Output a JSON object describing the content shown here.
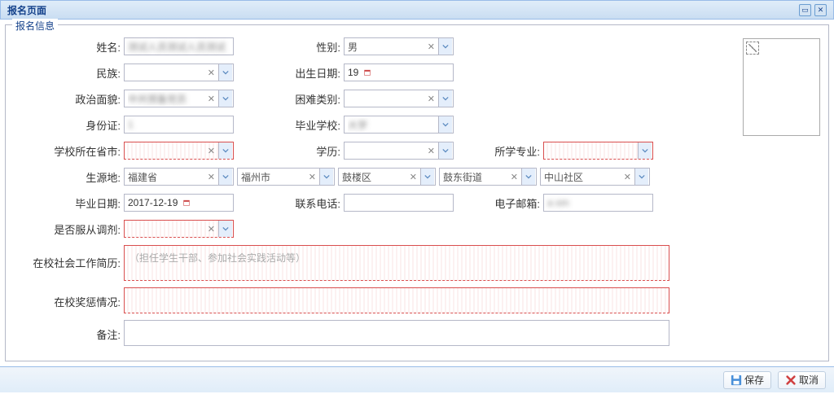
{
  "window": {
    "title": "报名页面"
  },
  "fieldset": {
    "legend": "报名信息"
  },
  "labels": {
    "name": "姓名:",
    "gender": "性别:",
    "nation": "民族:",
    "birth": "出生日期:",
    "political": "政治面貌:",
    "difficulty": "困难类别:",
    "idcard": "身份证:",
    "gradschool": "毕业学校:",
    "schoolcity": "学校所在省市:",
    "education": "学历:",
    "major": "所学专业:",
    "origin": "生源地:",
    "graddate": "毕业日期:",
    "phone": "联系电话:",
    "email": "电子邮箱:",
    "accept": "是否服从调剂:",
    "resume": "在校社会工作简历:",
    "award": "在校奖惩情况:",
    "remark": "备注:"
  },
  "values": {
    "name": "测试人员测试人员测试",
    "gender": "男",
    "nation": "",
    "birth": "19",
    "political": "中共预备党员",
    "difficulty": "",
    "idcard": "1",
    "gradschool": "大学",
    "schoolcity": "",
    "education": "",
    "major": "",
    "origin_prov": "福建省",
    "origin_city": "福州市",
    "origin_dist": "鼓楼区",
    "origin_street": "鼓东街道",
    "origin_comm": "中山社区",
    "graddate": "2017-12-19",
    "phone": "",
    "email": "a          om",
    "accept": "",
    "resume_placeholder": "（担任学生干部、参加社会实践活动等）"
  },
  "actions": {
    "save": "保存",
    "cancel": "取消"
  }
}
